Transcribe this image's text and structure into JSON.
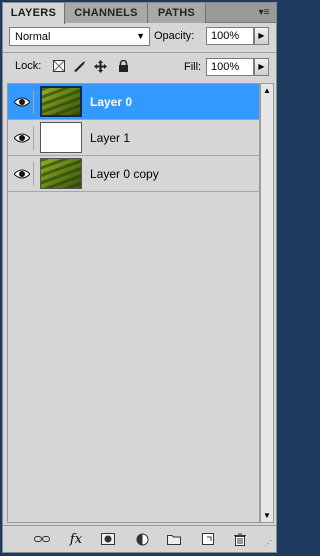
{
  "tabs": [
    {
      "label": "LAYERS",
      "active": true
    },
    {
      "label": "CHANNELS",
      "active": false
    },
    {
      "label": "PATHS",
      "active": false
    }
  ],
  "panel_menu_icon": "panel-menu-icon",
  "blend_mode": {
    "value": "Normal"
  },
  "opacity": {
    "label": "Opacity:",
    "value": "100%"
  },
  "lock": {
    "label": "Lock:",
    "icons": [
      "lock-transparent-icon",
      "lock-image-icon",
      "lock-position-icon",
      "lock-all-icon"
    ]
  },
  "fill": {
    "label": "Fill:",
    "value": "100%"
  },
  "layers": [
    {
      "name": "Layer 0",
      "selected": true,
      "thumb": "photo"
    },
    {
      "name": "Layer 1",
      "selected": false,
      "thumb": "white"
    },
    {
      "name": "Layer 0 copy",
      "selected": false,
      "thumb": "photo"
    }
  ],
  "bottom_icons": [
    "link-layers-icon",
    "fx-icon",
    "mask-icon",
    "adjustment-icon",
    "folder-icon",
    "new-layer-icon",
    "trash-icon"
  ],
  "colors": {
    "selected": "#3399ff",
    "panel": "#d6d6d6"
  }
}
